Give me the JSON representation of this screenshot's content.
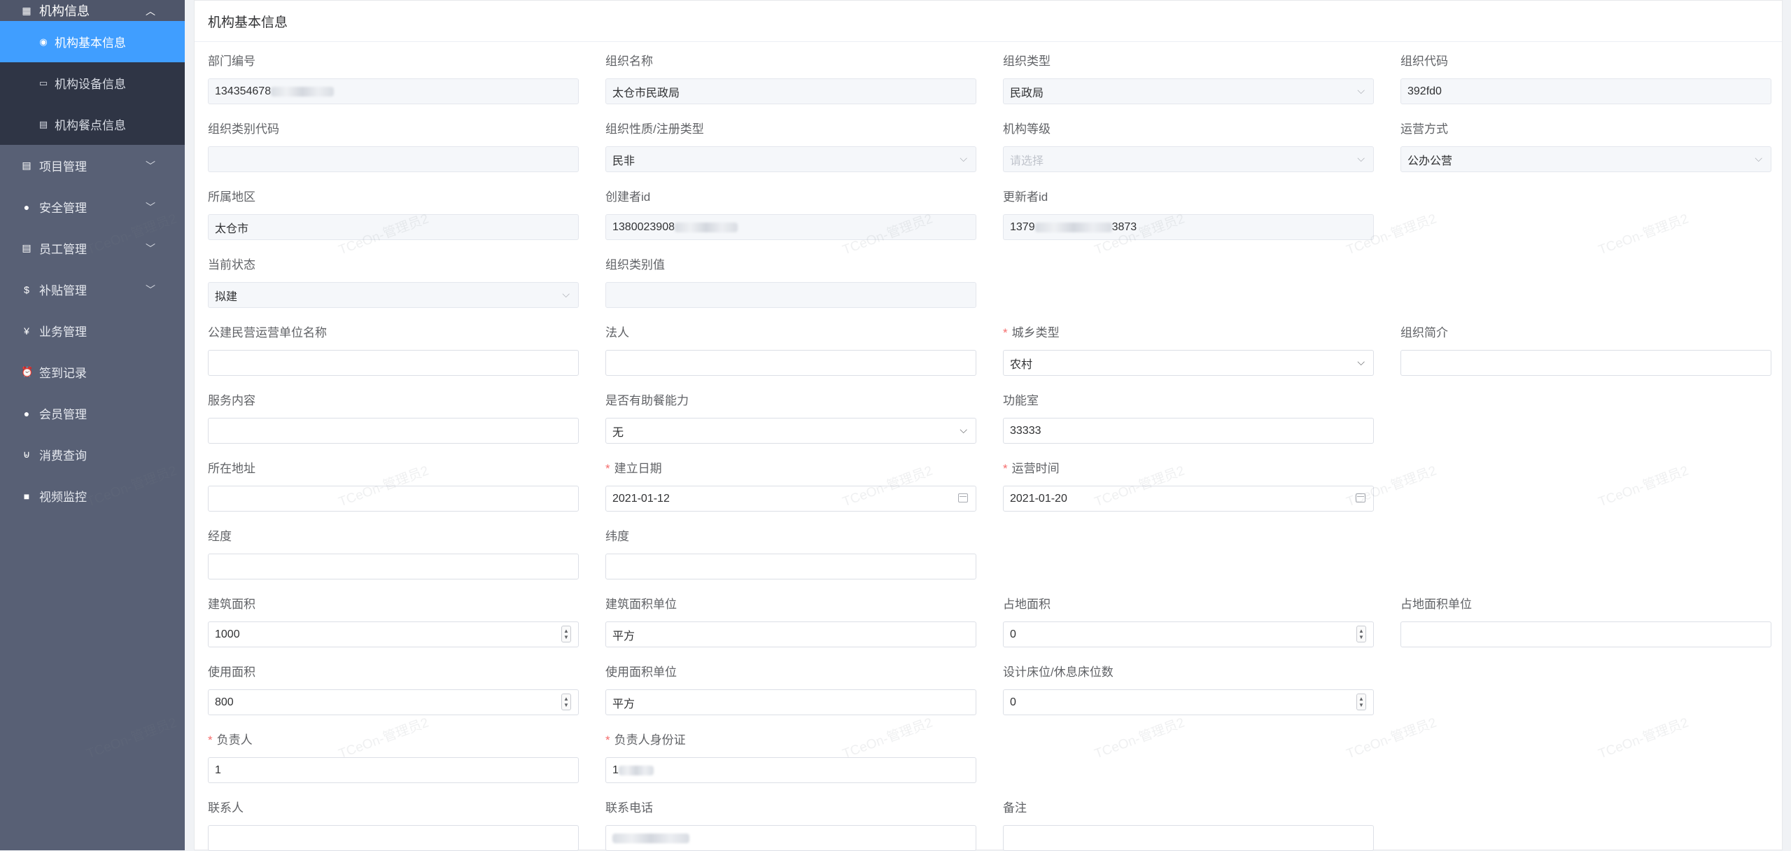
{
  "sidebar": {
    "root": {
      "label": "机构信息",
      "icon": "grid-icon"
    },
    "sub_items": [
      {
        "label": "机构基本信息",
        "icon": "circle-icon",
        "active": true
      },
      {
        "label": "机构设备信息",
        "icon": "monitor-icon"
      },
      {
        "label": "机构餐点信息",
        "icon": "doc-icon"
      }
    ],
    "items": [
      {
        "label": "项目管理",
        "icon": "doc-icon",
        "has_children": true
      },
      {
        "label": "安全管理",
        "icon": "pin-icon",
        "has_children": true
      },
      {
        "label": "员工管理",
        "icon": "doc-icon",
        "has_children": true
      },
      {
        "label": "补贴管理",
        "icon": "dollar-icon",
        "has_children": true
      },
      {
        "label": "业务管理",
        "icon": "yen-icon"
      },
      {
        "label": "签到记录",
        "icon": "alarm-icon"
      },
      {
        "label": "会员管理",
        "icon": "user-icon"
      },
      {
        "label": "消费查询",
        "icon": "cart-icon"
      },
      {
        "label": "视频监控",
        "icon": "camera-icon"
      }
    ]
  },
  "card": {
    "title": "机构基本信息"
  },
  "watermark": "TCeOn-管理员2",
  "form": {
    "dept_no": {
      "label": "部门编号",
      "value": "134354678"
    },
    "org_name": {
      "label": "组织名称",
      "value": "太仓市民政局"
    },
    "org_type": {
      "label": "组织类型",
      "value": "民政局"
    },
    "org_code": {
      "label": "组织代码",
      "value": "392fd0"
    },
    "org_cat_code": {
      "label": "组织类别代码",
      "value": ""
    },
    "org_nature": {
      "label": "组织性质/注册类型",
      "value": "民非"
    },
    "org_level": {
      "label": "机构等级",
      "placeholder": "请选择"
    },
    "op_mode": {
      "label": "运营方式",
      "value": "公办公营"
    },
    "region": {
      "label": "所属地区",
      "value": "太仓市"
    },
    "creator_id": {
      "label": "创建者id",
      "value": "1380023908"
    },
    "updater_id": {
      "label": "更新者id",
      "prefix": "1379",
      "suffix": "3873"
    },
    "status": {
      "label": "当前状态",
      "value": "拟建"
    },
    "org_cat_value": {
      "label": "组织类别值",
      "value": ""
    },
    "operator_name": {
      "label": "公建民营运营单位名称",
      "value": ""
    },
    "legal_person": {
      "label": "法人",
      "value": ""
    },
    "urban_rural": {
      "label": "城乡类型",
      "value": "农村"
    },
    "org_intro": {
      "label": "组织简介",
      "value": ""
    },
    "service": {
      "label": "服务内容",
      "value": ""
    },
    "meal_ability": {
      "label": "是否有助餐能力",
      "value": "无"
    },
    "function_room": {
      "label": "功能室",
      "value": "33333"
    },
    "address": {
      "label": "所在地址",
      "value": ""
    },
    "found_date": {
      "label": "建立日期",
      "value": "2021-01-12"
    },
    "op_time": {
      "label": "运营时间",
      "value": "2021-01-20"
    },
    "longitude": {
      "label": "经度",
      "value": ""
    },
    "latitude": {
      "label": "纬度",
      "value": ""
    },
    "build_area": {
      "label": "建筑面积",
      "value": "1000"
    },
    "build_area_unit": {
      "label": "建筑面积单位",
      "value": "平方"
    },
    "land_area": {
      "label": "占地面积",
      "value": "0"
    },
    "land_area_unit": {
      "label": "占地面积单位",
      "value": ""
    },
    "use_area": {
      "label": "使用面积",
      "value": "800"
    },
    "use_area_unit": {
      "label": "使用面积单位",
      "value": "平方"
    },
    "beds": {
      "label": "设计床位/休息床位数",
      "value": "0"
    },
    "manager": {
      "label": "负责人",
      "value": "1"
    },
    "manager_id": {
      "label": "负责人身份证",
      "value": "1"
    },
    "contact": {
      "label": "联系人",
      "value": ""
    },
    "phone": {
      "label": "联系电话",
      "value": ""
    },
    "remark": {
      "label": "备注",
      "value": ""
    }
  }
}
